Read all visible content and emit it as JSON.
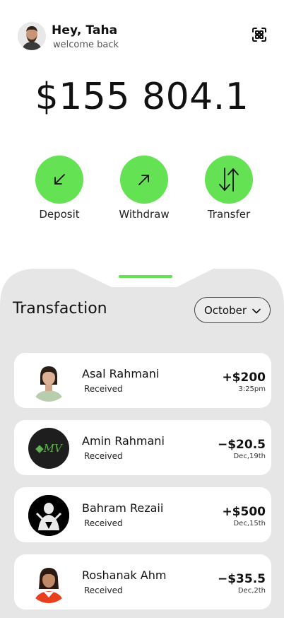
{
  "user": {
    "greeting": "Hey, Taha",
    "subtitle": "welcome back"
  },
  "balance": "$155 804.1",
  "actions": [
    {
      "label": "Deposit",
      "icon": "arrow-down-left-icon"
    },
    {
      "label": "Withdraw",
      "icon": "arrow-up-right-icon"
    },
    {
      "label": "Transfer",
      "icon": "arrows-up-down-icon"
    }
  ],
  "transactions_section": {
    "title": "Transfaction",
    "month": "October"
  },
  "transactions": [
    {
      "name": "Asal Rahmani",
      "status": "Received",
      "amount": "+$200",
      "time": "3:25pm"
    },
    {
      "name": "Amin Rahmani",
      "status": "Received",
      "amount": "−$20.5",
      "time": "Dec,19th",
      "avatar_text": "◆MV"
    },
    {
      "name": "Bahram Rezaii",
      "status": "Received",
      "amount": "+$500",
      "time": "Dec,15th"
    },
    {
      "name": "Roshanak Ahm",
      "status": "Received",
      "amount": "−$35.5",
      "time": "Dec,2th"
    }
  ],
  "colors": {
    "accent": "#64e253",
    "sheet": "#e6e6e6",
    "card": "#ffffff"
  }
}
